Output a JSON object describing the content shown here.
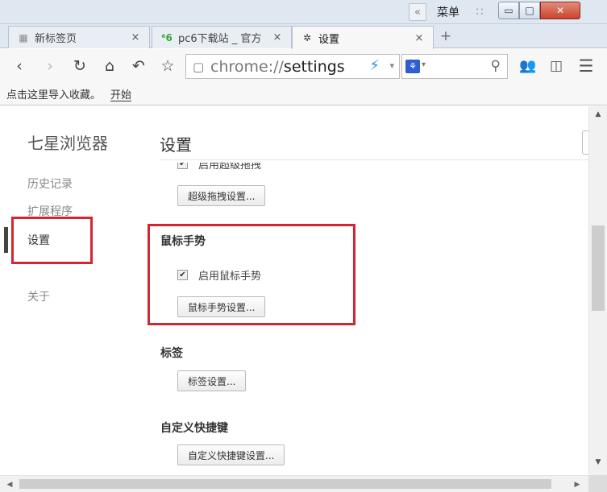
{
  "titlebar": {
    "collapse_icon": "«",
    "menu_label": "菜单",
    "grid_icon": "∷",
    "minimize_icon": "▭",
    "maximize_icon": "□",
    "close_icon": "✕"
  },
  "tabs": [
    {
      "icon": "▦",
      "label": "新标签页",
      "close": "×"
    },
    {
      "icon": "⁶6",
      "label": "pc6下载站 _ 官方",
      "close": "×"
    },
    {
      "icon": "✲",
      "label": "设置",
      "close": "×"
    }
  ],
  "new_tab_icon": "+",
  "toolbar": {
    "back_icon": "‹",
    "forward_icon": "›",
    "reload_icon": "↻",
    "home_icon": "⌂",
    "undo_icon": "↶",
    "star_icon": "☆",
    "page_icon": "▢",
    "url_scheme": "chrome://",
    "url_host": "settings",
    "bolt_icon": "⚡",
    "caret_icon": "▾",
    "search_engine_icon": "⚘",
    "search_caret": "▾",
    "search_icon": "⚲",
    "user_icon": "👥",
    "window_icon": "◫",
    "menu_icon": "☰"
  },
  "bookmarks": {
    "import_text": "点击这里导入收藏。",
    "start_text": "开始"
  },
  "sidebar": {
    "brand": "七星浏览器",
    "items": [
      "历史记录",
      "扩展程序",
      "设置",
      "关于"
    ]
  },
  "content": {
    "title": "设置",
    "cut_checkbox_label": "启用超级拖拽",
    "drag_settings_button": "超级拖拽设置...",
    "mouse_section_title": "鼠标手势",
    "mouse_checkbox_label": "启用鼠标手势",
    "mouse_checkbox_mark": "✔",
    "mouse_settings_button": "鼠标手势设置...",
    "tabs_section_title": "标签",
    "tabs_settings_button": "标签设置...",
    "shortcut_section_title": "自定义快捷键",
    "shortcut_settings_button": "自定义快捷键设置..."
  },
  "scrollbar": {
    "up_arrow": "▲",
    "down_arrow": "▼",
    "left_arrow": "◀",
    "right_arrow": "▶"
  },
  "colors": {
    "highlight_red": "#d42631",
    "titlebar_bg": "#dfe7f1",
    "toolbar_bg": "#f7f7f7"
  }
}
